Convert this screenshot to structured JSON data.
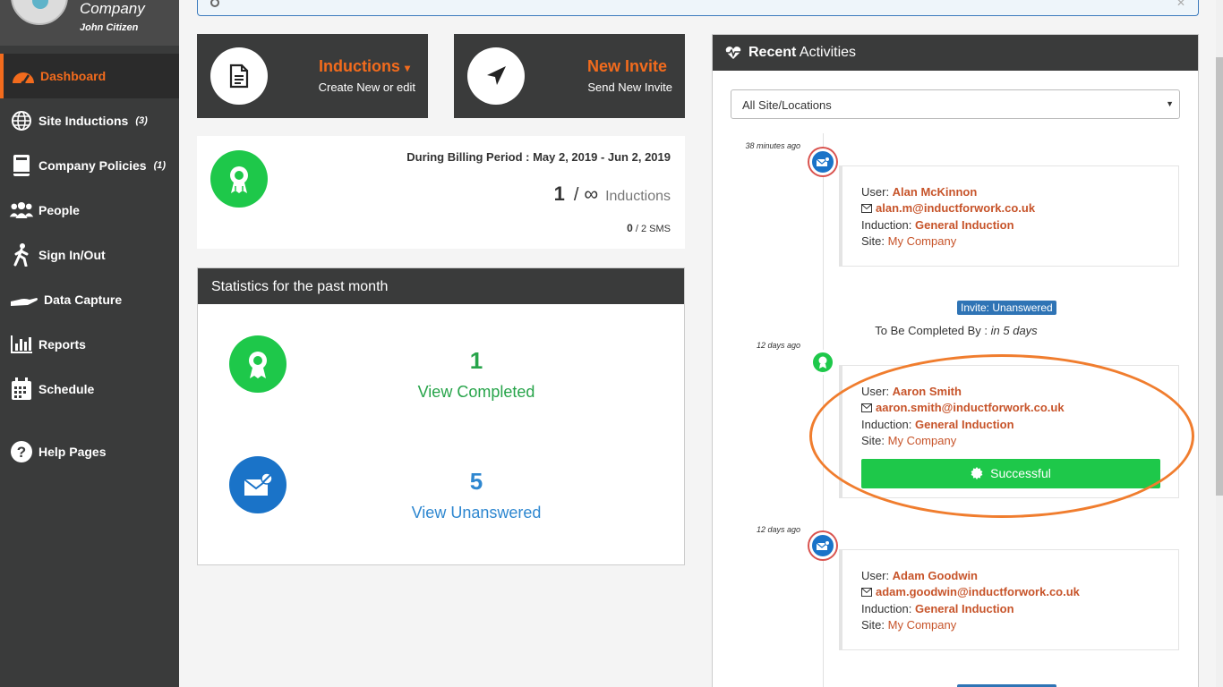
{
  "sidebar": {
    "company": "Company",
    "user": "John Citizen",
    "items": [
      {
        "label": "Dashboard",
        "count": ""
      },
      {
        "label": "Site Inductions",
        "count": "(3)"
      },
      {
        "label": "Company Policies",
        "count": "(1)"
      },
      {
        "label": "People",
        "count": ""
      },
      {
        "label": "Sign In/Out",
        "count": ""
      },
      {
        "label": "Data Capture",
        "count": ""
      },
      {
        "label": "Reports",
        "count": ""
      },
      {
        "label": "Schedule",
        "count": ""
      },
      {
        "label": "Help Pages",
        "count": ""
      }
    ]
  },
  "tiles": {
    "inductions": {
      "title": "Inductions",
      "caret": "▾",
      "subtitle": "Create New or edit"
    },
    "invite": {
      "title": "New Invite",
      "subtitle": "Send New Invite"
    }
  },
  "billing": {
    "period": "During Billing Period : May 2, 2019 - Jun 2, 2019",
    "count": "1",
    "slash": "/",
    "limit": "∞",
    "label": "Inductions",
    "sms_used": "0",
    "sms_total": "/ 2 SMS"
  },
  "stats": {
    "title": "Statistics for the past month",
    "completed_count": "1",
    "completed_label": "View Completed",
    "unanswered_count": "5",
    "unanswered_label": "View Unanswered"
  },
  "recent": {
    "title_bold": "Recent",
    "title_rest": " Activities",
    "filter": "All Site/Locations",
    "labels": {
      "user": "User: ",
      "induction": "Induction: ",
      "site": "Site: "
    },
    "entries": [
      {
        "time": "38 minutes ago",
        "user": "Alan McKinnon",
        "email": "alan.m@inductforwork.co.uk",
        "induction": "General Induction",
        "site": "My Company"
      },
      {
        "time": "12 days ago",
        "user": "Aaron Smith",
        "email": "aaron.smith@inductforwork.co.uk",
        "induction": "General Induction",
        "site": "My Company",
        "result": "Successful"
      },
      {
        "time": "12 days ago",
        "user": "Adam Goodwin",
        "email": "adam.goodwin@inductforwork.co.uk",
        "induction": "General Induction",
        "site": "My Company"
      }
    ],
    "invite_badge": "Invite: Unanswered",
    "to_be_completed": "To Be Completed By : ",
    "due": "in 5 days"
  },
  "colors": {
    "accent": "#f26b1d",
    "success": "#1ec84a",
    "info": "#1a73c8",
    "sidebar": "#3a3b3b"
  }
}
